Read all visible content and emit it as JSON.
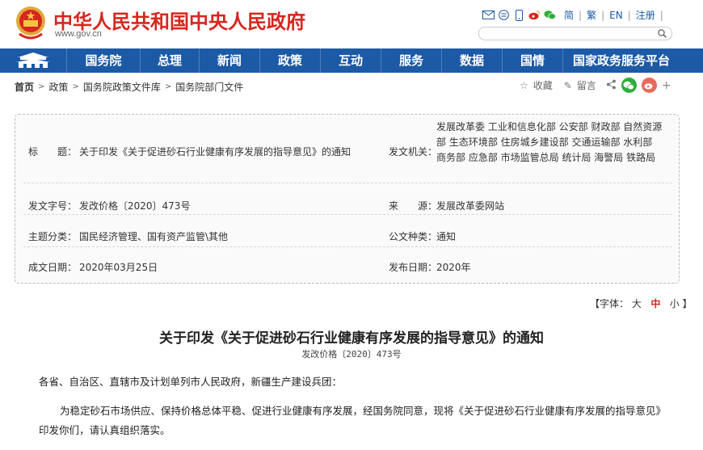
{
  "header": {
    "site_title": "中华人民共和国中央人民政府",
    "site_url": "www.gov.cn",
    "links": [
      "简",
      "繁",
      "EN",
      "注册"
    ],
    "search_placeholder": ""
  },
  "nav": {
    "items": [
      "国务院",
      "总理",
      "新闻",
      "政策",
      "互动",
      "服务",
      "数据",
      "国情",
      "国家政务服务平台"
    ]
  },
  "breadcrumb": {
    "items": [
      "首页",
      "政策",
      "国务院政策文件库",
      "国务院部门文件"
    ]
  },
  "tools": {
    "favorite": "收藏",
    "comment": "留言"
  },
  "info": {
    "title_label": "标　　题：",
    "title_value": "关于印发《关于促进砂石行业健康有序发展的指导意见》的通知",
    "issuer_label": "发文机关：",
    "issuer_value": "发展改革委  工业和信息化部  公安部  财政部  自然资源部  生态环境部  住房城乡建设部  交通运输部  水利部  商务部  应急部  市场监管总局  统计局  海警局  铁路局",
    "docno_label": "发文字号：",
    "docno_value": "发改价格〔2020〕473号",
    "source_label": "来　　源：",
    "source_value": "发展改革委网站",
    "topic_label": "主题分类：",
    "topic_value": "国民经济管理、国有资产监管\\其他",
    "type_label": "公文种类：",
    "type_value": "通知",
    "date_label": "成文日期：",
    "date_value": "2020年03月25日",
    "pub_label": "发布日期：",
    "pub_value": "2020年"
  },
  "font_size": {
    "prefix": "【字体：",
    "large": "大",
    "medium": "中",
    "small": "小",
    "suffix": "】"
  },
  "document": {
    "title": "关于印发《关于促进砂石行业健康有序发展的指导意见》的通知",
    "number": "发改价格〔2020〕473号",
    "salutation": "各省、自治区、直辖市及计划单列市人民政府，新疆生产建设兵团：",
    "body": "为稳定砂石市场供应、保持价格总体平稳、促进行业健康有序发展，经国务院同意，现将《关于促进砂石行业健康有序发展的指导意见》印发你们，请认真组织落实。"
  },
  "colors": {
    "brand_red": "#d7261e",
    "nav_blue": "#1d5aa6"
  }
}
